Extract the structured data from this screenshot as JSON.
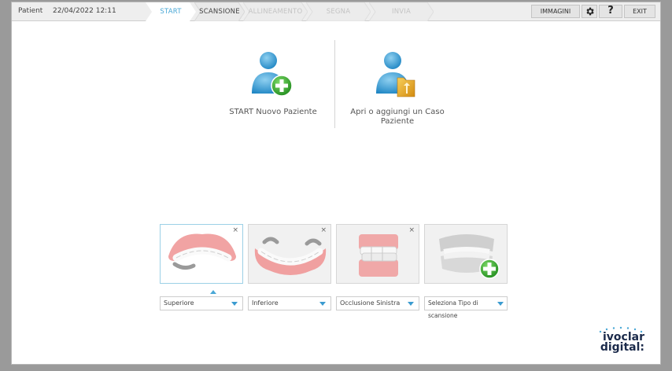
{
  "topbar": {
    "patient_label": "Patient",
    "datetime": "22/04/2022 12:11",
    "workflow": [
      {
        "label": "START",
        "state": "active"
      },
      {
        "label": "SCANSIONE",
        "state": "normal"
      },
      {
        "label": "ALLINEAMENTO",
        "state": "disabled"
      },
      {
        "label": "SEGNA",
        "state": "disabled"
      },
      {
        "label": "INVIA",
        "state": "disabled"
      }
    ],
    "images_button": "IMMAGINI",
    "help_label": "?",
    "exit_button": "EXIT"
  },
  "actions": {
    "new_patient": "START Nuovo Paziente",
    "open_case": "Apri o aggiungi un Caso Paziente"
  },
  "scan_types": [
    {
      "label": "Superiore",
      "selected": true,
      "removable": true
    },
    {
      "label": "Inferiore",
      "selected": false,
      "removable": true
    },
    {
      "label": "Occlusione Sinistra",
      "selected": false,
      "removable": true
    },
    {
      "label": "Seleziona Tipo di scansione",
      "selected": false,
      "removable": false
    }
  ],
  "close_glyph": "×",
  "brand": {
    "line1": "ivoclar",
    "line2": "digital:"
  },
  "colors": {
    "accent": "#4aa8d6",
    "active_step_bg": "#ffffff",
    "green": "#3aa935",
    "topbar": "#eeeeee"
  }
}
